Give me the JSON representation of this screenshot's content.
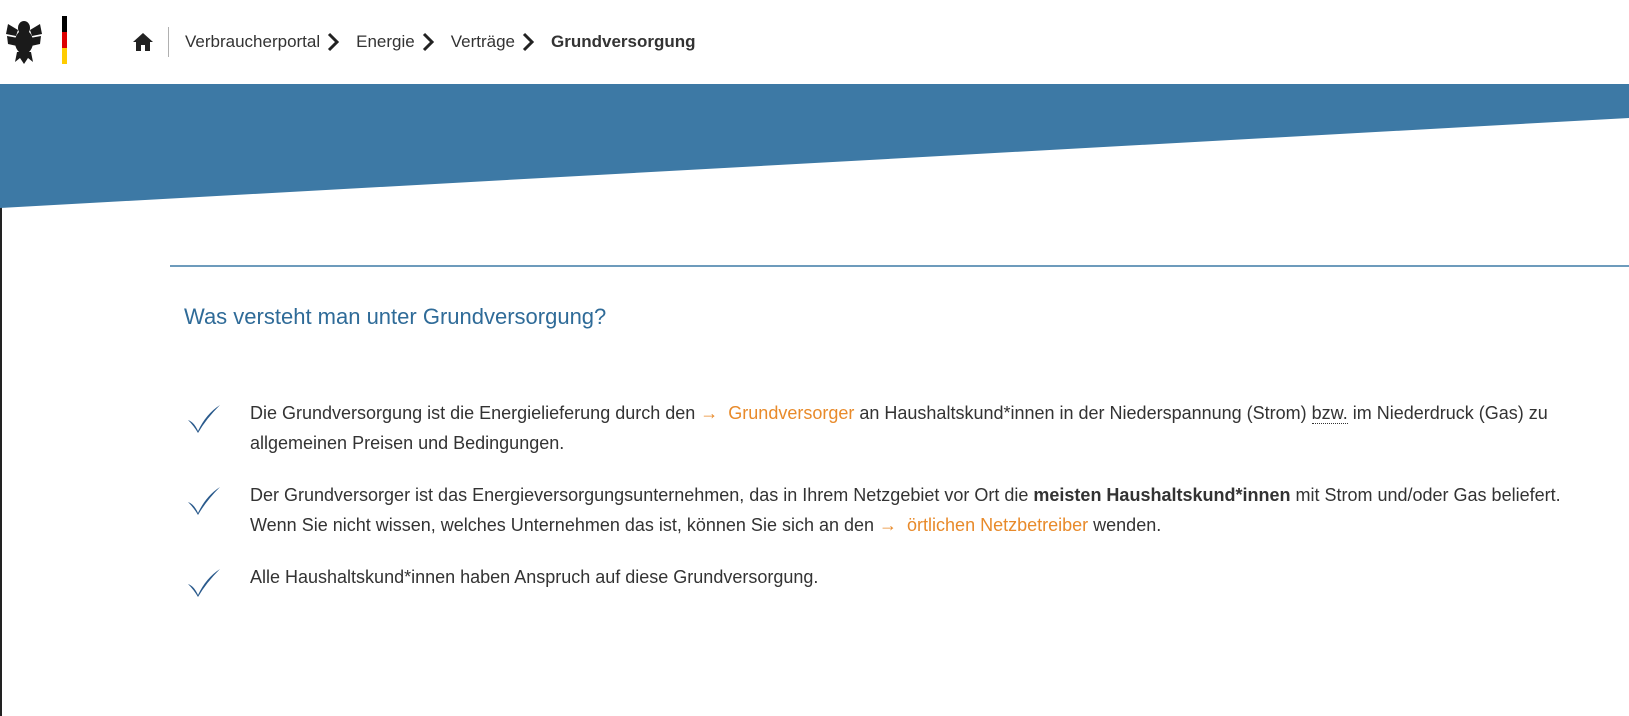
{
  "breadcrumb": {
    "home_icon": "home-icon",
    "items": [
      "Verbraucherportal",
      "Energie",
      "Verträge"
    ],
    "current": "Grundversorgung"
  },
  "colors": {
    "banner": "#3d79a5",
    "heading": "#2f6b98",
    "link": "#e88a2a",
    "check": "#2a5a8c"
  },
  "section": {
    "title": "Was versteht man unter Grundversorgung?"
  },
  "items": {
    "one": {
      "pre": "Die Grundversorgung ist die Energielieferung durch den",
      "link": "Grundversorger",
      "mid": "an Haushaltskund*innen in der Niederspannung (Strom)",
      "abbr": "bzw.",
      "post": "im Niederdruck (Gas) zu allgemeinen Preisen und Bedingungen."
    },
    "two": {
      "pre": "Der Grundversorger ist das Energieversorgungsunternehmen, das in Ihrem Netzgebiet vor Ort die",
      "bold": "meisten Haushaltskund*innen",
      "mid": "mit Strom und/oder Gas beliefert. Wenn Sie nicht wissen, welches Unternehmen das ist, können Sie sich an den",
      "link": "örtlichen Netzbetreiber",
      "post": "wenden."
    },
    "three": {
      "text": "Alle Haushaltskund*innen haben Anspruch auf diese Grundversorgung."
    }
  }
}
